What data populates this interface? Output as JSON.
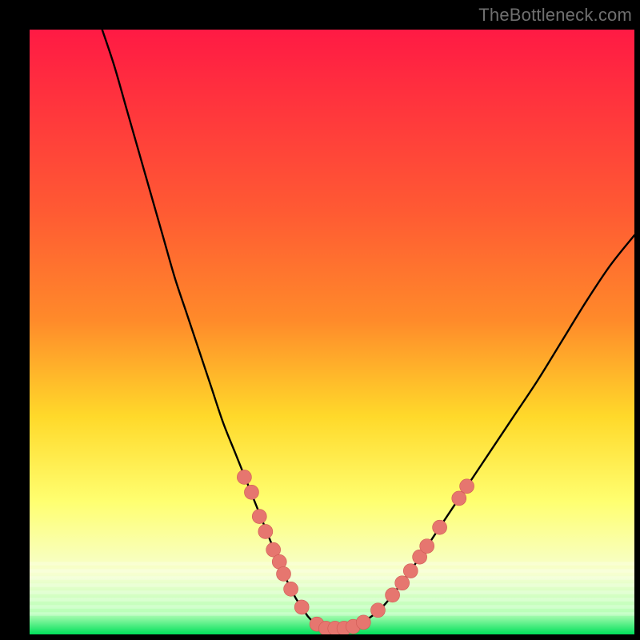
{
  "watermark": "TheBottleneck.com",
  "colors": {
    "frame": "#000000",
    "gradient_top": "#ff1a44",
    "gradient_mid1": "#ff8a2a",
    "gradient_mid2": "#ffd92a",
    "gradient_mid3": "#ffff70",
    "gradient_mid4": "#f6ffd0",
    "gradient_bottom": "#00e05a",
    "curve": "#000000",
    "marker_fill": "#e6766f",
    "marker_stroke": "#cf5a54"
  },
  "chart_data": {
    "type": "line",
    "title": "",
    "xlabel": "",
    "ylabel": "",
    "xlim": [
      0,
      100
    ],
    "ylim": [
      0,
      100
    ],
    "curve": {
      "x": [
        12,
        14,
        16,
        18,
        20,
        22,
        24,
        26,
        28,
        30,
        32,
        34,
        36,
        38,
        39,
        40,
        41,
        42,
        43,
        44,
        45,
        46,
        47,
        48,
        49,
        50,
        52,
        54,
        56,
        58,
        60,
        64,
        68,
        72,
        76,
        80,
        84,
        88,
        92,
        96,
        100
      ],
      "y": [
        100,
        94,
        87,
        80,
        73,
        66,
        59,
        53,
        47,
        41,
        35,
        30,
        25,
        20,
        17.5,
        15,
        12.5,
        10,
        8,
        6,
        4.5,
        3,
        2,
        1.4,
        1.0,
        1.0,
        1.0,
        1.4,
        2.6,
        4.2,
        6.5,
        12,
        18,
        24,
        30,
        36,
        42,
        48.5,
        55,
        61,
        66
      ]
    },
    "markers": [
      {
        "x": 35.5,
        "y": 26
      },
      {
        "x": 36.7,
        "y": 23.5
      },
      {
        "x": 38.0,
        "y": 19.5
      },
      {
        "x": 39.0,
        "y": 17
      },
      {
        "x": 40.3,
        "y": 14
      },
      {
        "x": 41.3,
        "y": 12
      },
      {
        "x": 42.0,
        "y": 10
      },
      {
        "x": 43.2,
        "y": 7.5
      },
      {
        "x": 45.0,
        "y": 4.5
      },
      {
        "x": 47.5,
        "y": 1.7
      },
      {
        "x": 49.0,
        "y": 1.0
      },
      {
        "x": 50.5,
        "y": 1.0
      },
      {
        "x": 52.0,
        "y": 1.0
      },
      {
        "x": 53.5,
        "y": 1.3
      },
      {
        "x": 55.2,
        "y": 2.0
      },
      {
        "x": 57.6,
        "y": 4.0
      },
      {
        "x": 60.0,
        "y": 6.5
      },
      {
        "x": 61.6,
        "y": 8.5
      },
      {
        "x": 63.0,
        "y": 10.5
      },
      {
        "x": 64.5,
        "y": 12.8
      },
      {
        "x": 65.7,
        "y": 14.6
      },
      {
        "x": 67.8,
        "y": 17.7
      },
      {
        "x": 71.0,
        "y": 22.5
      },
      {
        "x": 72.3,
        "y": 24.5
      }
    ]
  }
}
